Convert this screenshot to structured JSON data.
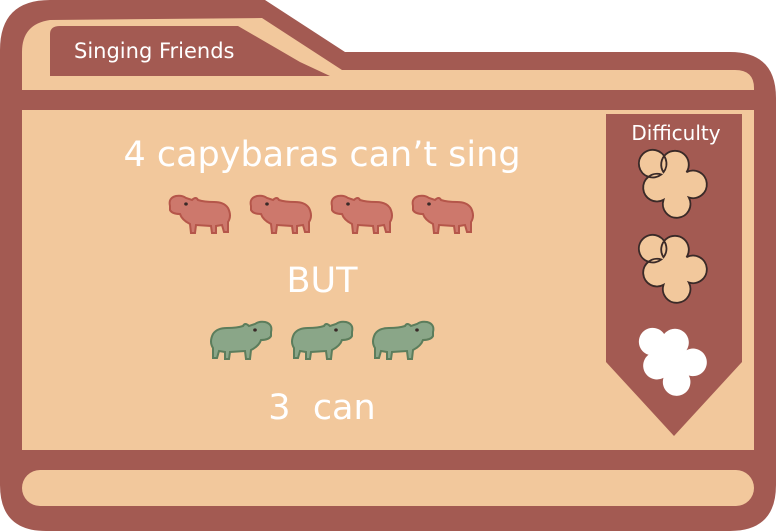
{
  "card": {
    "tab_title": "Singing Friends",
    "line1": "4 capybaras can’t sing",
    "line2": "BUT",
    "line3": "3  can"
  },
  "groups": {
    "cannot_sing_count": 4,
    "can_sing_count": 3,
    "cannot_sing_icon": "capybara-icon",
    "can_sing_icon": "capybara-icon"
  },
  "difficulty": {
    "label": "Difficulty",
    "levels_total": 3,
    "levels_filled": 2,
    "icon": "quatrefoil-icon"
  },
  "colors": {
    "frame": "#a35a52",
    "panel": "#f2c89c",
    "text": "#ffffff",
    "capybara_red": "#cd786c",
    "capybara_red_outline": "#b5564a",
    "capybara_green": "#8aa688",
    "capybara_green_outline": "#5c7d5c",
    "difficulty_filled": "#f2c89c",
    "difficulty_empty": "#ffffff"
  }
}
